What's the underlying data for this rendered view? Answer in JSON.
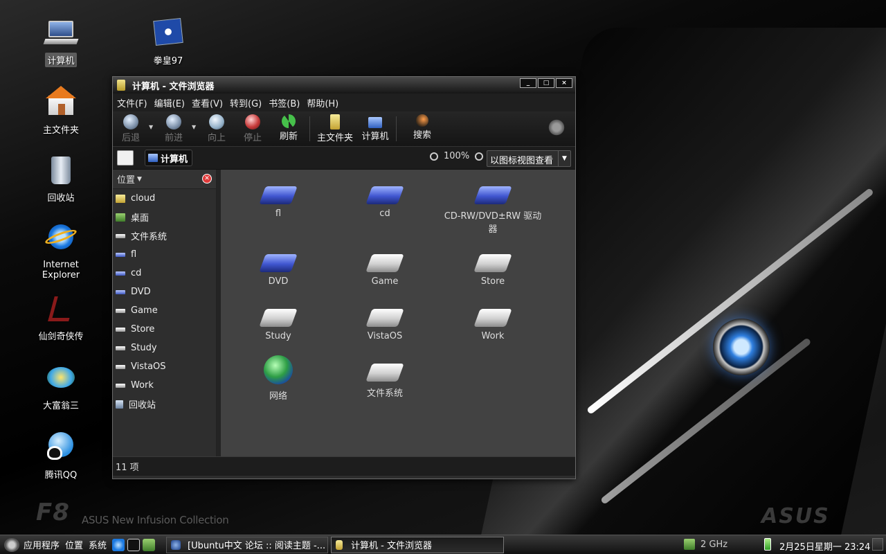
{
  "desktop": {
    "icons": [
      {
        "label": "计算机",
        "icon": "computer-icon",
        "selected": true
      },
      {
        "label": "拳皇97",
        "icon": "game-icon"
      },
      {
        "label": "主文件夹",
        "icon": "home-folder-icon"
      },
      {
        "label": "回收站",
        "icon": "trash-icon"
      },
      {
        "label": "Internet Explorer",
        "icon": "internet-explorer-icon"
      },
      {
        "label": "仙剑奇侠传",
        "icon": "game-icon"
      },
      {
        "label": "大富翁三",
        "icon": "game-icon"
      },
      {
        "label": "腾讯QQ",
        "icon": "qq-icon"
      }
    ],
    "wallpaper": {
      "model": "F8",
      "tagline": "ASUS New Infusion Collection",
      "brand": "ASUS"
    }
  },
  "window": {
    "title": "计算机 - 文件浏览器",
    "controls": {
      "minimize": "_",
      "maximize": "□",
      "close": "×"
    },
    "menu": [
      "文件(F)",
      "编辑(E)",
      "查看(V)",
      "转到(G)",
      "书签(B)",
      "帮助(H)"
    ],
    "toolbar": {
      "back": "后退",
      "forward": "前进",
      "up": "向上",
      "stop": "停止",
      "reload": "刷新",
      "home": "主文件夹",
      "computer": "计算机",
      "search": "搜索"
    },
    "location": {
      "crumb": "计算机",
      "zoom": "100%",
      "view_mode": "以图标视图查看"
    },
    "sidebar": {
      "title": "位置",
      "items": [
        {
          "label": "cloud",
          "icon": "folder-icon"
        },
        {
          "label": "桌面",
          "icon": "desktop-icon"
        },
        {
          "label": "文件系统",
          "icon": "drive-icon"
        },
        {
          "label": "fl",
          "icon": "cd-drive-icon"
        },
        {
          "label": "cd",
          "icon": "cd-drive-icon"
        },
        {
          "label": "DVD",
          "icon": "cd-drive-icon"
        },
        {
          "label": "Game",
          "icon": "drive-icon"
        },
        {
          "label": "Store",
          "icon": "drive-icon"
        },
        {
          "label": "Study",
          "icon": "drive-icon"
        },
        {
          "label": "VistaOS",
          "icon": "drive-icon"
        },
        {
          "label": "Work",
          "icon": "drive-icon"
        },
        {
          "label": "回收站",
          "icon": "trash-icon"
        }
      ]
    },
    "files": [
      {
        "label": "fl",
        "icon": "cd-drive-icon"
      },
      {
        "label": "cd",
        "icon": "cd-drive-icon"
      },
      {
        "label": "CD-RW/DVD±RW 驱动器",
        "icon": "cd-drive-icon"
      },
      {
        "label": "DVD",
        "icon": "cd-drive-icon"
      },
      {
        "label": "Game",
        "icon": "drive-icon"
      },
      {
        "label": "Store",
        "icon": "drive-icon"
      },
      {
        "label": "Study",
        "icon": "drive-icon"
      },
      {
        "label": "VistaOS",
        "icon": "drive-icon"
      },
      {
        "label": "Work",
        "icon": "drive-icon"
      },
      {
        "label": "网络",
        "icon": "network-icon"
      },
      {
        "label": "文件系统",
        "icon": "drive-icon"
      }
    ],
    "status": "11 项"
  },
  "taskbar": {
    "menus": [
      "应用程序",
      "位置",
      "系统"
    ],
    "tasks": [
      "[Ubuntu中文 论坛 :: 阅读主题 -...",
      "计算机 - 文件浏览器"
    ],
    "cpu": "2 GHz",
    "clock": "2月25日星期一 23:24"
  }
}
